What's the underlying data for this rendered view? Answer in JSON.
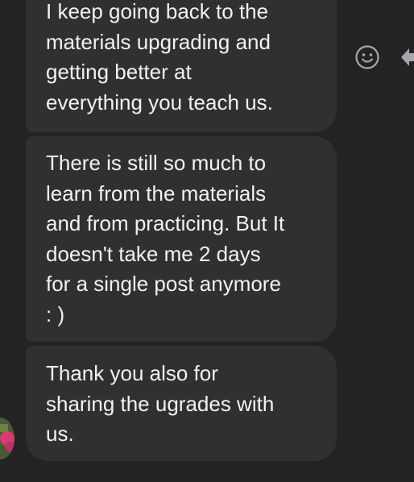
{
  "messages": [
    {
      "text": "I keep going back to the\nmaterials upgrading and\ngetting better at\neverything you teach us."
    },
    {
      "text": "There is still so much to\nlearn from the materials\nand from practicing. But It\ndoesn't take me 2 days\nfor a single post anymore\n: )"
    },
    {
      "text": "Thank you also for\nsharing the ugrades with\nus."
    }
  ],
  "icons": {
    "react": "smiley-face-icon",
    "more": "back-arrow-icon",
    "avatar": "sender-avatar"
  },
  "colors": {
    "background": "#232325",
    "bubble": "#303032",
    "text": "#f2f2f4",
    "icon": "#a6a6aa"
  }
}
